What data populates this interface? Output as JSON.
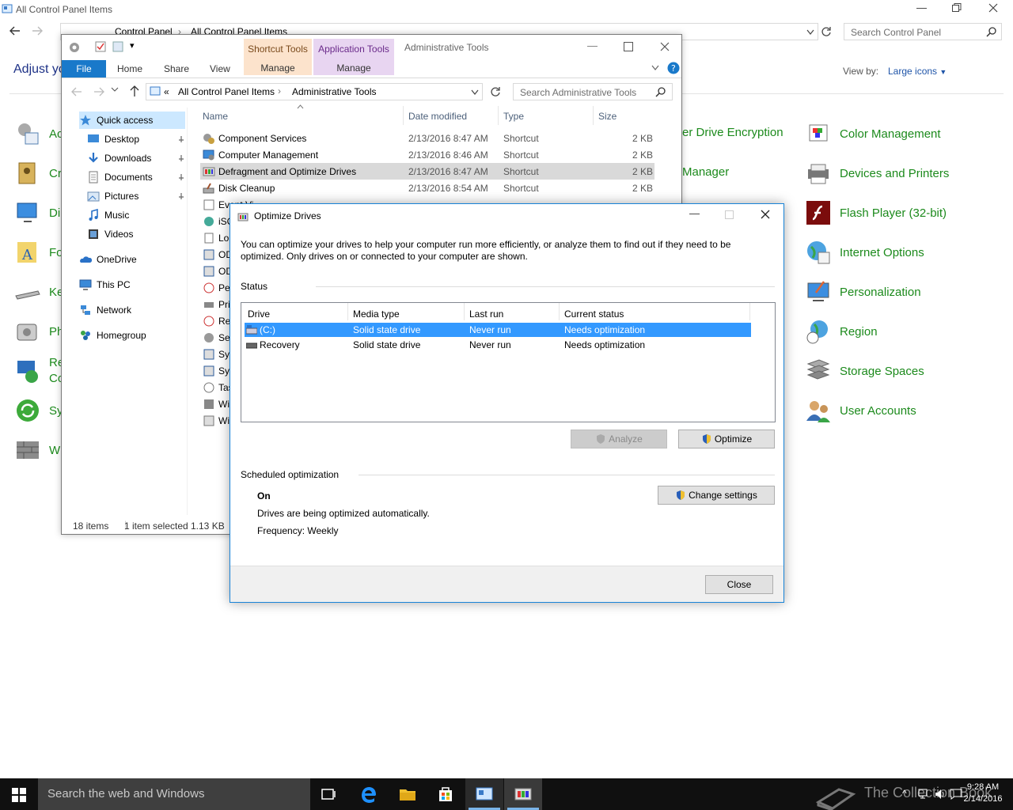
{
  "control_panel": {
    "window_title": "All Control Panel Items",
    "address": [
      "Control Panel",
      "All Control Panel Items"
    ],
    "search_placeholder": "Search Control Panel",
    "heading": "Adjust yo",
    "view_by_label": "View by:",
    "view_by_value": "Large icons",
    "left_items": [
      "Ac",
      "Cr",
      "Di",
      "Fo",
      "Ke",
      "Ph",
      "Re",
      "Co",
      "Sy",
      "W"
    ],
    "middle_items": [
      "er Drive Encryption",
      "Manager"
    ],
    "right_items": [
      "Color Management",
      "Devices and Printers",
      "Flash Player (32-bit)",
      "Internet Options",
      "Personalization",
      "Region",
      "Storage Spaces",
      "User Accounts"
    ]
  },
  "explorer": {
    "ribbon_context": {
      "shortcut_tools": "Shortcut Tools",
      "application_tools": "Application Tools",
      "manage_1": "Manage",
      "manage_2": "Manage",
      "title": "Administrative Tools"
    },
    "ribbon_tabs": {
      "file": "File",
      "home": "Home",
      "share": "Share",
      "view": "View"
    },
    "address": [
      "«",
      "All Control Panel Items",
      "Administrative Tools"
    ],
    "search_placeholder": "Search Administrative Tools",
    "nav": {
      "quick_access": "Quick access",
      "desktop": "Desktop",
      "downloads": "Downloads",
      "documents": "Documents",
      "pictures": "Pictures",
      "music": "Music",
      "videos": "Videos",
      "onedrive": "OneDrive",
      "this_pc": "This PC",
      "network": "Network",
      "homegroup": "Homegroup"
    },
    "columns": {
      "name": "Name",
      "date": "Date modified",
      "type": "Type",
      "size": "Size"
    },
    "files": [
      {
        "name": "Component Services",
        "date": "2/13/2016 8:47 AM",
        "type": "Shortcut",
        "size": "2 KB"
      },
      {
        "name": "Computer Management",
        "date": "2/13/2016 8:46 AM",
        "type": "Shortcut",
        "size": "2 KB"
      },
      {
        "name": "Defragment and Optimize Drives",
        "date": "2/13/2016 8:47 AM",
        "type": "Shortcut",
        "size": "2 KB"
      },
      {
        "name": "Disk Cleanup",
        "date": "2/13/2016 8:54 AM",
        "type": "Shortcut",
        "size": "2 KB"
      }
    ],
    "partial_files": [
      "Event Vi",
      "iSC",
      "Lo",
      "OD",
      "OD",
      "Pe",
      "Pri",
      "Re",
      "Se",
      "Sys",
      "Sys",
      "Tas",
      "Wi",
      "Wi"
    ],
    "status": {
      "count": "18 items",
      "selected": "1 item selected",
      "size": "1.13 KB"
    }
  },
  "dialog": {
    "title": "Optimize Drives",
    "description": "You can optimize your drives to help your computer run more efficiently, or analyze them to find out if they need to be optimized. Only drives on or connected to your computer are shown.",
    "status_label": "Status",
    "columns": {
      "drive": "Drive",
      "media": "Media type",
      "last": "Last run",
      "status": "Current status"
    },
    "drives": [
      {
        "drive": "(C:)",
        "media": "Solid state drive",
        "last": "Never run",
        "status": "Needs optimization"
      },
      {
        "drive": "Recovery",
        "media": "Solid state drive",
        "last": "Never run",
        "status": "Needs optimization"
      }
    ],
    "analyze_label": "Analyze",
    "optimize_label": "Optimize",
    "scheduled_label": "Scheduled optimization",
    "schedule_state": "On",
    "schedule_desc": "Drives are being optimized automatically.",
    "frequency": "Frequency: Weekly",
    "change_settings_label": "Change settings",
    "close_label": "Close"
  },
  "taskbar": {
    "search_placeholder": "Search the web and Windows",
    "time": "9:28 AM",
    "date": "2/14/2016",
    "watermark": "The Collection Book"
  },
  "colors": {
    "accent": "#1979ca",
    "selection": "#3399ff",
    "cp_link": "#1c8a1c"
  }
}
